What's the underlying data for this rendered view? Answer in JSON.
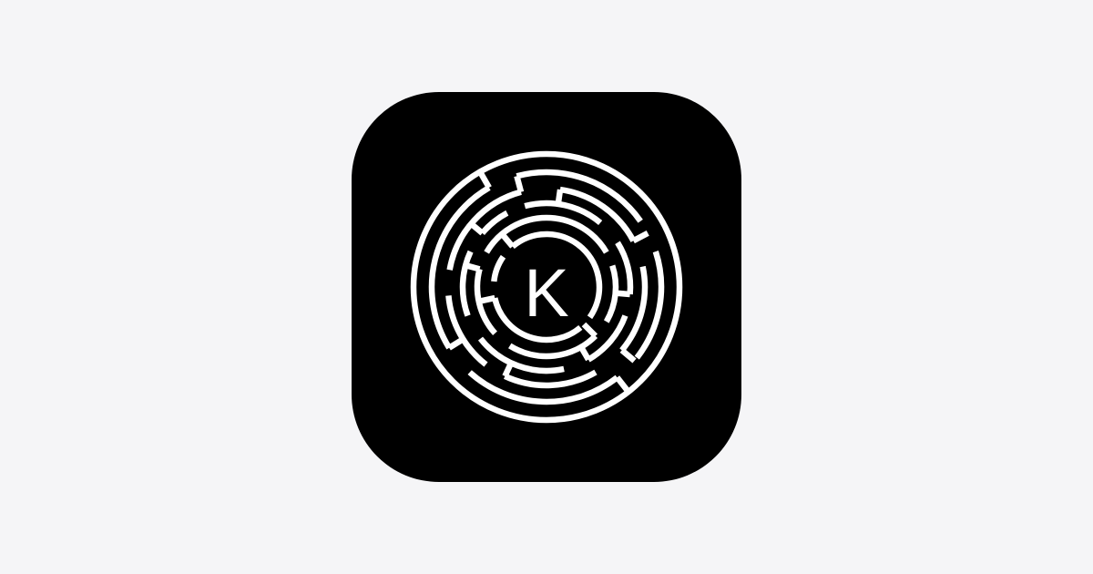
{
  "app_icon": {
    "name": "maze-k-logo",
    "icon": "maze-icon",
    "logo_letter": "K",
    "background_color": "#000000",
    "foreground_color": "#ffffff"
  },
  "page": {
    "background_color": "#f5f5f7"
  }
}
